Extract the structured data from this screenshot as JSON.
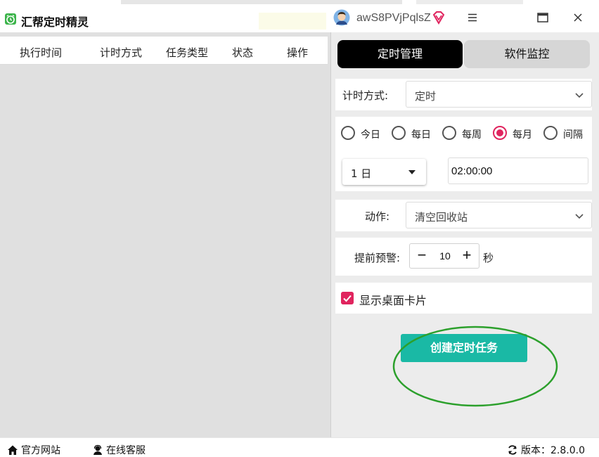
{
  "app": {
    "title": "汇帮定时精灵",
    "username": "awS8PVjPqlsZ",
    "icon": "alarm-clock-icon"
  },
  "window_controls": [
    "menu-icon",
    "maximize-icon",
    "close-icon"
  ],
  "task_table": {
    "columns": [
      "执行时间",
      "计时方式",
      "任务类型",
      "状态",
      "操作"
    ],
    "rows": []
  },
  "tabs": [
    {
      "label": "定时管理",
      "active": true
    },
    {
      "label": "软件监控",
      "active": false
    }
  ],
  "timing_mode": {
    "label": "计时方式:",
    "value": "定时"
  },
  "frequency": {
    "options": [
      {
        "label": "今日",
        "checked": false
      },
      {
        "label": "每日",
        "checked": false
      },
      {
        "label": "每周",
        "checked": false
      },
      {
        "label": "每月",
        "checked": true
      },
      {
        "label": "间隔",
        "checked": false
      }
    ],
    "day_value": "1 日",
    "time_value": "02:00:00"
  },
  "action": {
    "label": "动作:",
    "value": "清空回收站"
  },
  "warning": {
    "label": "提前预警:",
    "value": "10",
    "unit": "秒"
  },
  "show_card": {
    "label": "显示桌面卡片",
    "checked": true
  },
  "create_button": "创建定时任务",
  "footer": {
    "website": "官方网站",
    "support": "在线客服",
    "version": "版本：2.8.0.0"
  },
  "colors": {
    "accent_pink": "#e0245e",
    "create_green": "#1ab9a5",
    "active_tab": "#000000",
    "highlight_ring": "#2ca02c"
  }
}
